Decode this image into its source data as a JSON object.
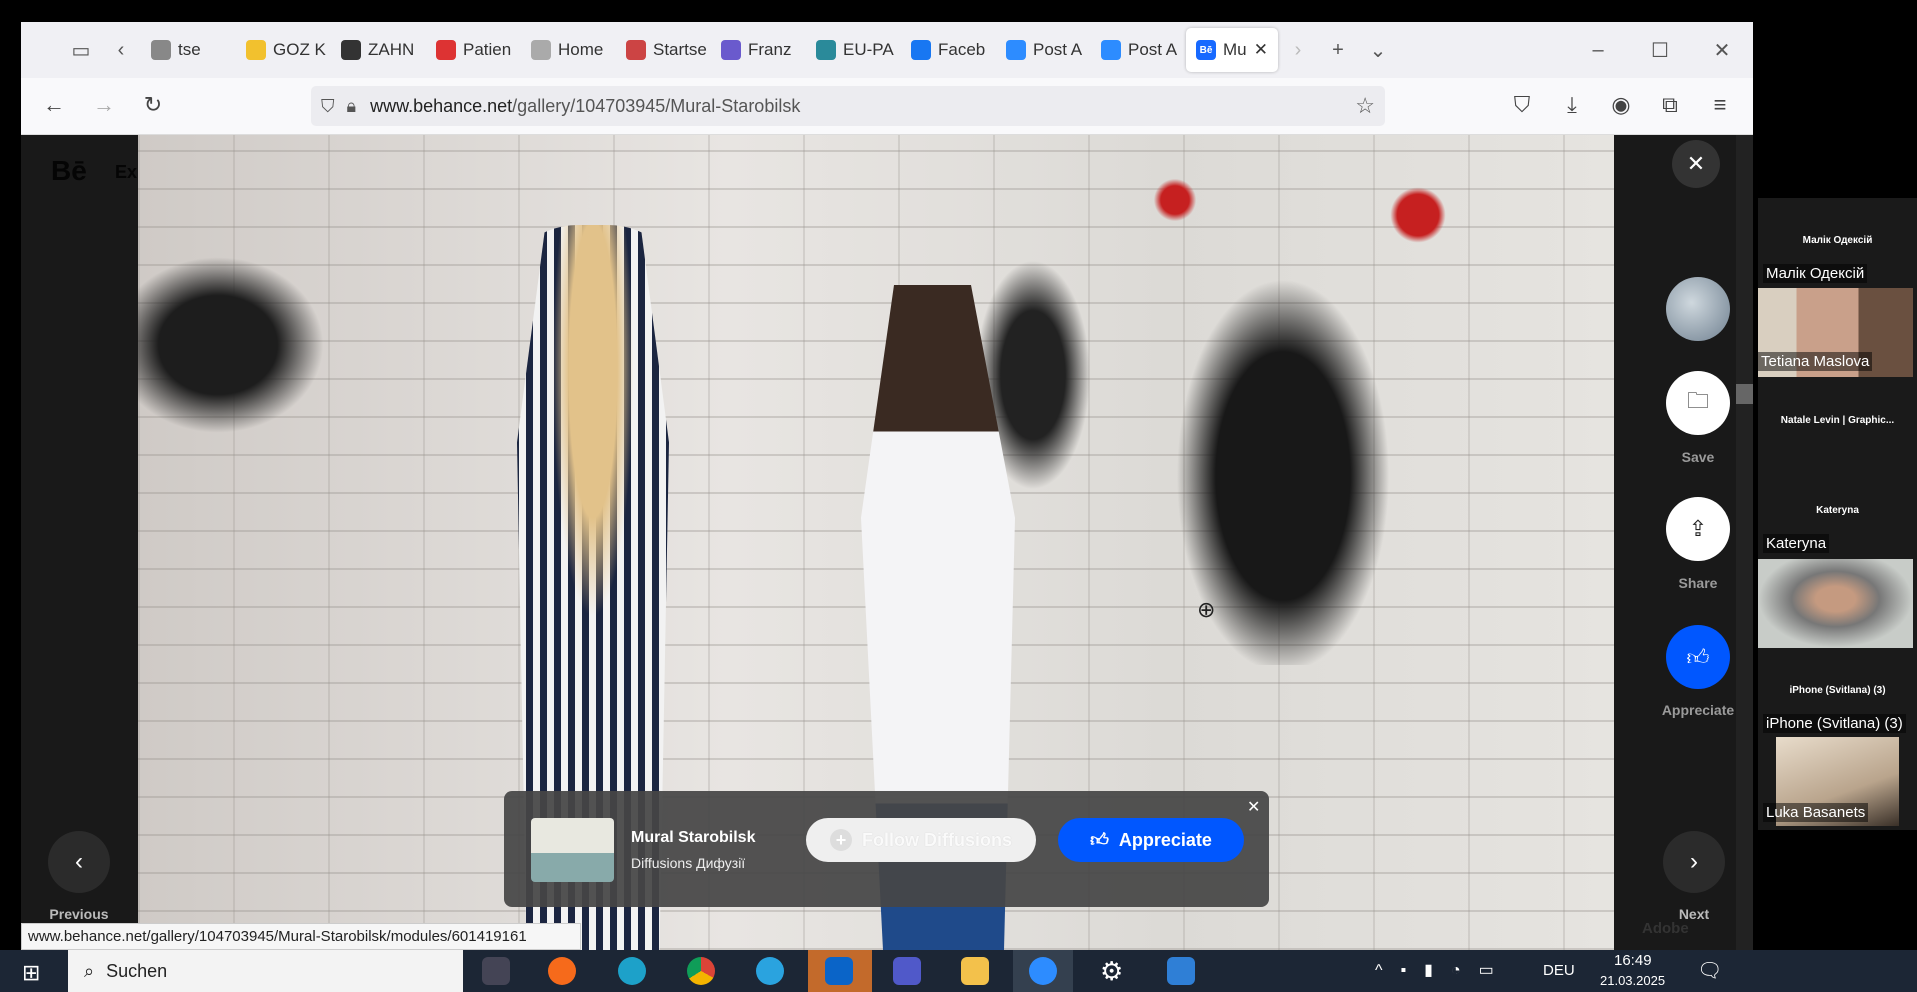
{
  "browser": {
    "tabs": [
      {
        "label": "tse",
        "color": "#888"
      },
      {
        "label": "GOZ K",
        "color": "#f2c12e"
      },
      {
        "label": "ZAHN",
        "color": "#333"
      },
      {
        "label": "Patien",
        "color": "#d33"
      },
      {
        "label": "Home",
        "color": "#aaa"
      },
      {
        "label": "Startse",
        "color": "#c44"
      },
      {
        "label": "Franz",
        "color": "#6a5acd"
      },
      {
        "label": "EU-PA",
        "color": "#2a8a9a"
      },
      {
        "label": "Faceb",
        "color": "#1877f2"
      },
      {
        "label": "Post A",
        "color": "#2d8cff"
      },
      {
        "label": "Post A",
        "color": "#2d8cff"
      },
      {
        "label": "Mu",
        "color": "#1769ff",
        "fav": "Bē",
        "active": true
      }
    ],
    "url_domain": "www.behance.net",
    "url_path": "/gallery/104703945/Mural-Starobilsk",
    "status_url": "www.behance.net/gallery/104703945/Mural-Starobilsk/modules/601419161"
  },
  "behance": {
    "logo": "Bē",
    "explore_partial": "Ex",
    "actions": {
      "save": "Save",
      "share": "Share",
      "appreciate": "Appreciate"
    },
    "previous": "Previous",
    "next": "Next",
    "adobe": "Adobe",
    "popup": {
      "title": "Mural Starobilsk",
      "owner": "Diffusions Дифузії",
      "follow": "Follow Diffusions",
      "appreciate": "Appreciate"
    },
    "accent": "#0057ff"
  },
  "zoom": {
    "participants": [
      {
        "small": "Малік Одексій",
        "name": "Малік Одексій"
      },
      {
        "name": "Tetiana Maslova"
      },
      {
        "small": "Natale Levin | Graphic..."
      },
      {
        "small": "Kateryna",
        "name": "Kateryna"
      },
      {
        "small": "iPhone (Svitlana) (3)",
        "name": "iPhone (Svitlana) (3)"
      },
      {
        "name": "Luka Basanets"
      }
    ]
  },
  "taskbar": {
    "search": "Suchen",
    "lang": "DEU",
    "time": "16:49",
    "date": "21.03.2025"
  }
}
